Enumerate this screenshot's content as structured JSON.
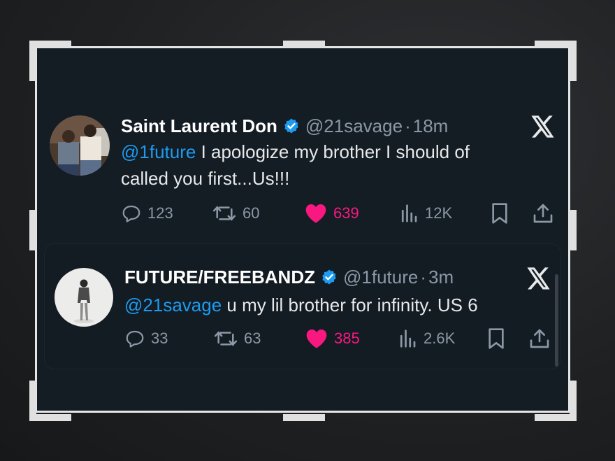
{
  "tweet1": {
    "display_name": "Saint Laurent Don",
    "handle": "@21savage",
    "separator": "·",
    "time": "18m",
    "mention": "@1future",
    "text_line1": " I apologize my brother I should of",
    "text_line2": "called you first...Us!!!",
    "replies": "123",
    "retweets": "60",
    "likes": "639",
    "views": "12K",
    "liked": true
  },
  "tweet2": {
    "display_name": "FUTURE/FREEBANDZ",
    "handle": "@1future",
    "separator": "·",
    "time": "3m",
    "mention": "@21savage",
    "text": " u my lil brother for infinity. US 6",
    "replies": "33",
    "retweets": "63",
    "likes": "385",
    "views": "2.6K",
    "liked": true
  },
  "colors": {
    "accent": "#1d9bf0",
    "like": "#f91880",
    "muted": "#8b98a5",
    "background": "#141c24"
  },
  "icons": [
    "verified-badge-icon",
    "x-logo-icon",
    "reply-icon",
    "retweet-icon",
    "heart-icon",
    "views-icon",
    "bookmark-icon",
    "share-icon"
  ]
}
